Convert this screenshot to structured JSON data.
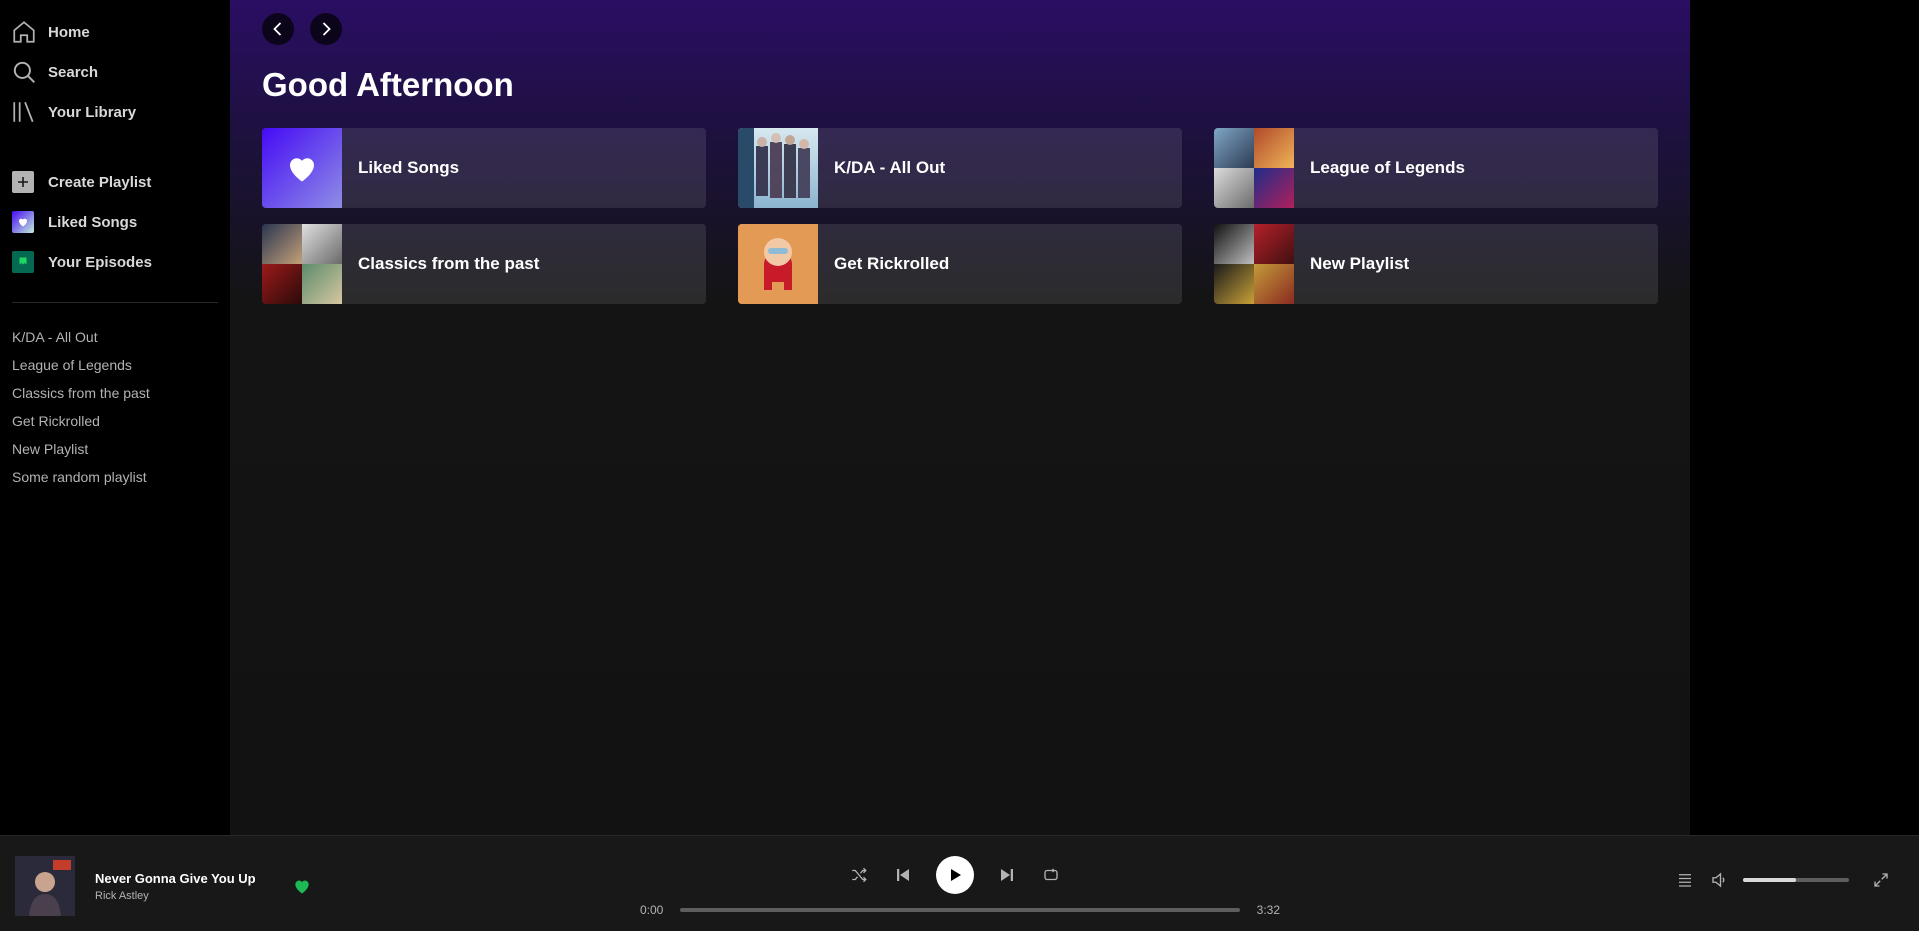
{
  "sidebar": {
    "nav": [
      {
        "label": "Home",
        "icon": "home-icon"
      },
      {
        "label": "Search",
        "icon": "search-icon"
      },
      {
        "label": "Your Library",
        "icon": "library-icon"
      }
    ],
    "actions": [
      {
        "label": "Create Playlist",
        "icon": "plus-icon"
      },
      {
        "label": "Liked Songs",
        "icon": "heart-icon"
      },
      {
        "label": "Your Episodes",
        "icon": "podcast-icon"
      }
    ],
    "playlists": [
      "K/DA - All Out",
      "League of Legends",
      "Classics from the past",
      "Get Rickrolled",
      "New Playlist",
      "Some random playlist"
    ]
  },
  "main": {
    "greeting": "Good Afternoon",
    "cards": [
      {
        "title": "Liked Songs"
      },
      {
        "title": "K/DA - All Out"
      },
      {
        "title": "League of Legends"
      },
      {
        "title": "Classics from the past"
      },
      {
        "title": "Get Rickrolled"
      },
      {
        "title": "New Playlist"
      }
    ]
  },
  "player": {
    "track_title": "Never Gonna Give You Up",
    "artist": "Rick Astley",
    "current_time": "0:00",
    "total_time": "3:32",
    "progress_fraction": 0.0,
    "volume_fraction": 0.5,
    "liked": true
  },
  "colors": {
    "accent_green": "#1db954",
    "main_gradient_top": "#2a0e63",
    "background": "#121212"
  }
}
